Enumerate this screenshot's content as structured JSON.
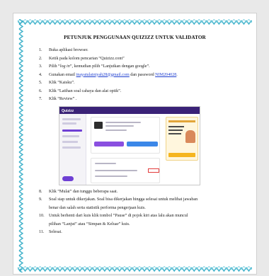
{
  "document": {
    "title": "PETUNJUK PENGGUNAAN QUIZIZZ UNTUK VALIDATOR",
    "steps": [
      {
        "num": "1.",
        "text": "Buka aplikasi browser."
      },
      {
        "num": "2.",
        "text": "Ketik pada kolom pencarian “Quizizz.com”"
      },
      {
        "num": "3.",
        "prefix": "Pilih “",
        "italic": "log in",
        "suffix": "”, kemudian pilih “Lanjutkan dengan google”."
      },
      {
        "num": "4.",
        "prefix": "Gunakan email ",
        "email": "inayatulainiyah28@gmail.com",
        "middle": " dan password ",
        "password": "NIM204028",
        "suffix": "."
      },
      {
        "num": "5.",
        "text": "Klik “Kaisku”."
      },
      {
        "num": "6.",
        "text": "Klik “Latihan soal cahaya dan alat optik”."
      },
      {
        "num": "7.",
        "text": "Klik “Review” ."
      },
      {
        "num": "8.",
        "text": "Klik “Mulai” dan tunggu beberapa saat."
      },
      {
        "num": "9.",
        "line1": "Soal siap untuk dikerjakan. Soal bisa dikerjakan hingga selesai untuk melihat jawaban",
        "line2": "benar dan salah serta statistik performa pengerjaan kuis."
      },
      {
        "num": "10.",
        "line1": "Untuk berhenti dari kuis klik tombol “Pause” di pojok kiri atas lalu akan muncul",
        "line2": "pilihan “Lanjut” atau “Simpan & Keluar” kuis."
      },
      {
        "num": "11.",
        "text": "Selesai."
      }
    ]
  },
  "screenshot": {
    "logo": "Quizizz"
  },
  "colors": {
    "border_zigzag": "#3bb0c9",
    "link": "#1f3fd0",
    "quizizz_purple": "#3a2277"
  }
}
